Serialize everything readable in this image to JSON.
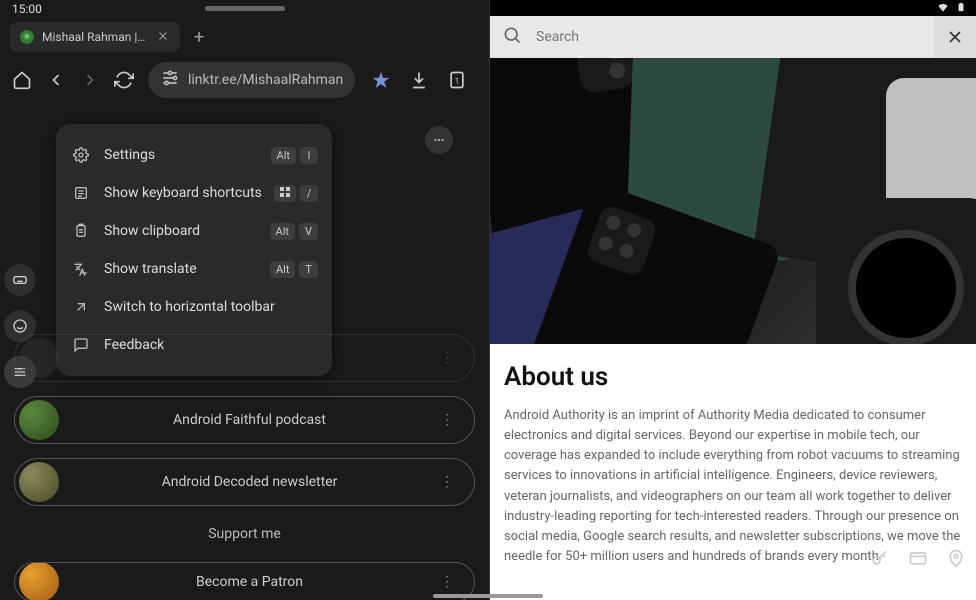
{
  "status": {
    "time": "15:00"
  },
  "tab": {
    "title": "Mishaal Rahman | Twitter | L"
  },
  "url": {
    "text": "linktr.ee/MishaalRahman"
  },
  "menu": {
    "items": [
      {
        "label": "Settings",
        "shortcut": [
          "Alt",
          "I"
        ]
      },
      {
        "label": "Show keyboard shortcuts",
        "shortcut": [
          "⌘",
          "/"
        ]
      },
      {
        "label": "Show clipboard",
        "shortcut": [
          "Alt",
          "V"
        ]
      },
      {
        "label": "Show translate",
        "shortcut": [
          "Alt",
          "T"
        ]
      },
      {
        "label": "Switch to horizontal toolbar",
        "shortcut": []
      },
      {
        "label": "Feedback",
        "shortcut": []
      }
    ]
  },
  "links": {
    "faithful": "Android Faithful podcast",
    "decoded": "Android Decoded newsletter",
    "support": "Support me",
    "patron": "Become a Patron"
  },
  "search": {
    "placeholder": "Search"
  },
  "article": {
    "title": "About us",
    "body": "Android Authority is an imprint of Authority Media dedicated to consumer electronics and digital services. Beyond our expertise in mobile tech, our coverage has expanded to include everything from robot vacuums to streaming services to innovations in artificial intelligence. Engineers, device reviewers, veteran journalists, and videographers on our team all work together to deliver industry-leading reporting for tech-interested readers. Through our presence on social media, Google search results, and newsletter subscriptions, we move the needle for 50+ million users and hundreds of brands every month."
  }
}
